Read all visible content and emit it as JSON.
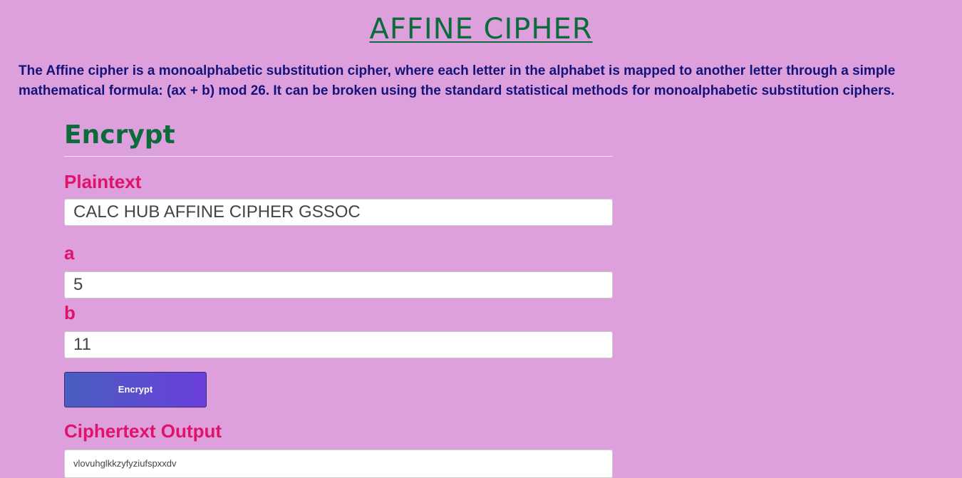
{
  "header": {
    "title": "AFFINE CIPHER",
    "description": "The Affine cipher is a monoalphabetic substitution cipher, where each letter in the alphabet is mapped to another letter through a simple mathematical formula: (ax + b) mod 26. It can be broken using the standard statistical methods for monoalphabetic substitution ciphers."
  },
  "encrypt": {
    "heading": "Encrypt",
    "plaintext_label": "Plaintext",
    "plaintext_value": "CALC HUB AFFINE CIPHER GSSOC",
    "a_label": "a",
    "a_value": "5",
    "b_label": "b",
    "b_value": "11",
    "button_label": "Encrypt",
    "output_label": "Ciphertext Output",
    "output_value": "vlovuhglkkzyfyziufspxxdv"
  },
  "colors": {
    "background": "#dda0dd",
    "title": "#0b6b3a",
    "description": "#13137a",
    "label": "#e0126a",
    "button_gradient_start": "#4a5ec0",
    "button_gradient_end": "#6a3fdc"
  }
}
